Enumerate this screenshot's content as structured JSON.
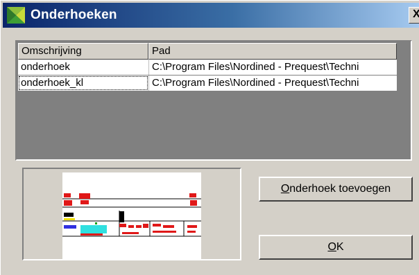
{
  "window": {
    "title": "Onderhoeken",
    "close_glyph": "X",
    "icon": "app-icon"
  },
  "listview": {
    "columns": [
      {
        "label": "Omschrijving"
      },
      {
        "label": "Pad"
      }
    ],
    "rows": [
      {
        "omschrijving": "onderhoek",
        "pad": "C:\\Program Files\\Nordined - Prequest\\Techni"
      },
      {
        "omschrijving": "onderhoek_kl",
        "pad": "C:\\Program Files\\Nordined - Prequest\\Techni"
      }
    ],
    "focused_row": 1
  },
  "preview": {
    "icon": "drawing-thumbnail"
  },
  "buttons": {
    "add_mnemonic": "O",
    "add_rest": "nderhoek toevoegen",
    "ok_mnemonic": "O",
    "ok_rest": "K"
  },
  "colors": {
    "titlebar_start": "#0a246a",
    "titlebar_end": "#a6caf0",
    "face": "#d4d0c8",
    "list_background": "#808080"
  }
}
